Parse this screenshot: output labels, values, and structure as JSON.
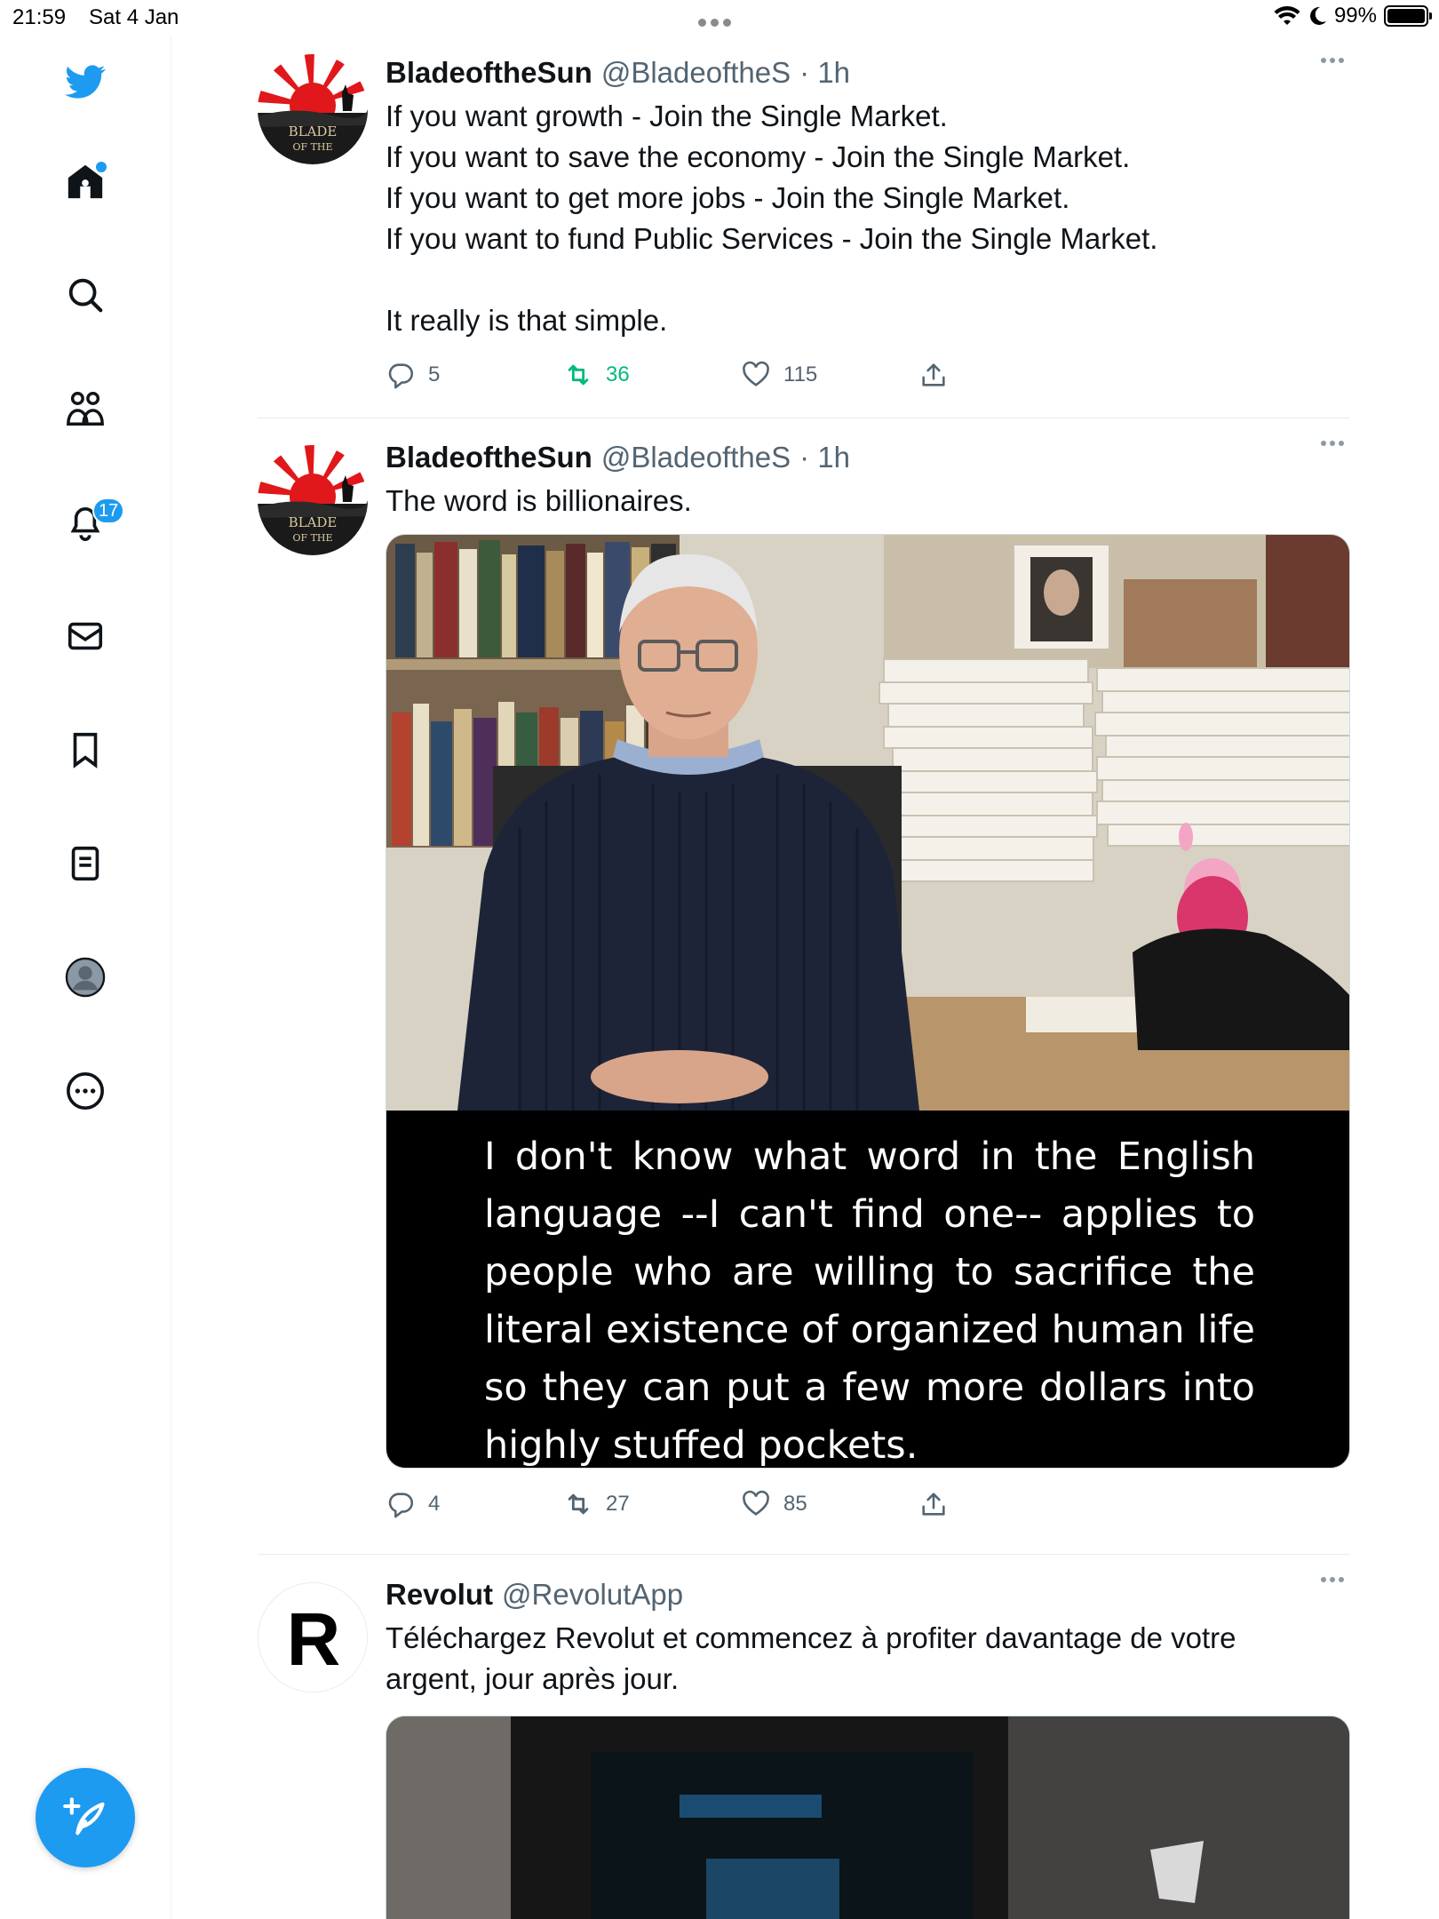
{
  "status_bar": {
    "time": "21:59",
    "date": "Sat 4 Jan",
    "battery": "99%",
    "battery_level": 0.99
  },
  "sidebar": {
    "items": [
      {
        "name": "twitter-logo-icon"
      },
      {
        "name": "home-icon"
      },
      {
        "name": "search-icon"
      },
      {
        "name": "communities-icon"
      },
      {
        "name": "notifications-icon",
        "badge": "17"
      },
      {
        "name": "messages-icon"
      },
      {
        "name": "bookmarks-icon"
      },
      {
        "name": "lists-icon"
      },
      {
        "name": "profile-icon"
      },
      {
        "name": "more-icon"
      }
    ],
    "compose": {
      "name": "compose-tweet-icon"
    }
  },
  "tweets": [
    {
      "name": "BladeoftheSun",
      "handle": "@BladeoftheS",
      "time": "· 1h",
      "lines": [
        "If you want growth - Join the Single Market.",
        "If you want to save the economy - Join the Single Market.",
        "If you want to get more jobs - Join the Single Market.",
        "If you want to fund Public Services - Join the Single Market.",
        "",
        "It really is that simple."
      ],
      "replies": "5",
      "retweets": "36",
      "likes": "115"
    },
    {
      "name": "BladeoftheSun",
      "handle": "@BladeoftheS",
      "time": "· 1h",
      "lines": [
        "The word is billionaires."
      ],
      "media_caption": "I don't know what word in the English language --I can't find one-- applies to people who are willing to sacrifice the literal existence of organized human life so they can put a few more dollars into highly stuffed pockets.",
      "replies": "4",
      "retweets": "27",
      "likes": "85"
    },
    {
      "name": "Revolut",
      "handle": "@RevolutApp",
      "time": "",
      "lines": [
        "Téléchargez Revolut et commencez à profiter davantage de votre",
        "argent, jour après jour."
      ]
    }
  ],
  "colors": {
    "accent": "#1d9bf0",
    "retweet_green": "#00ba7c",
    "secondary_text": "#536471"
  }
}
